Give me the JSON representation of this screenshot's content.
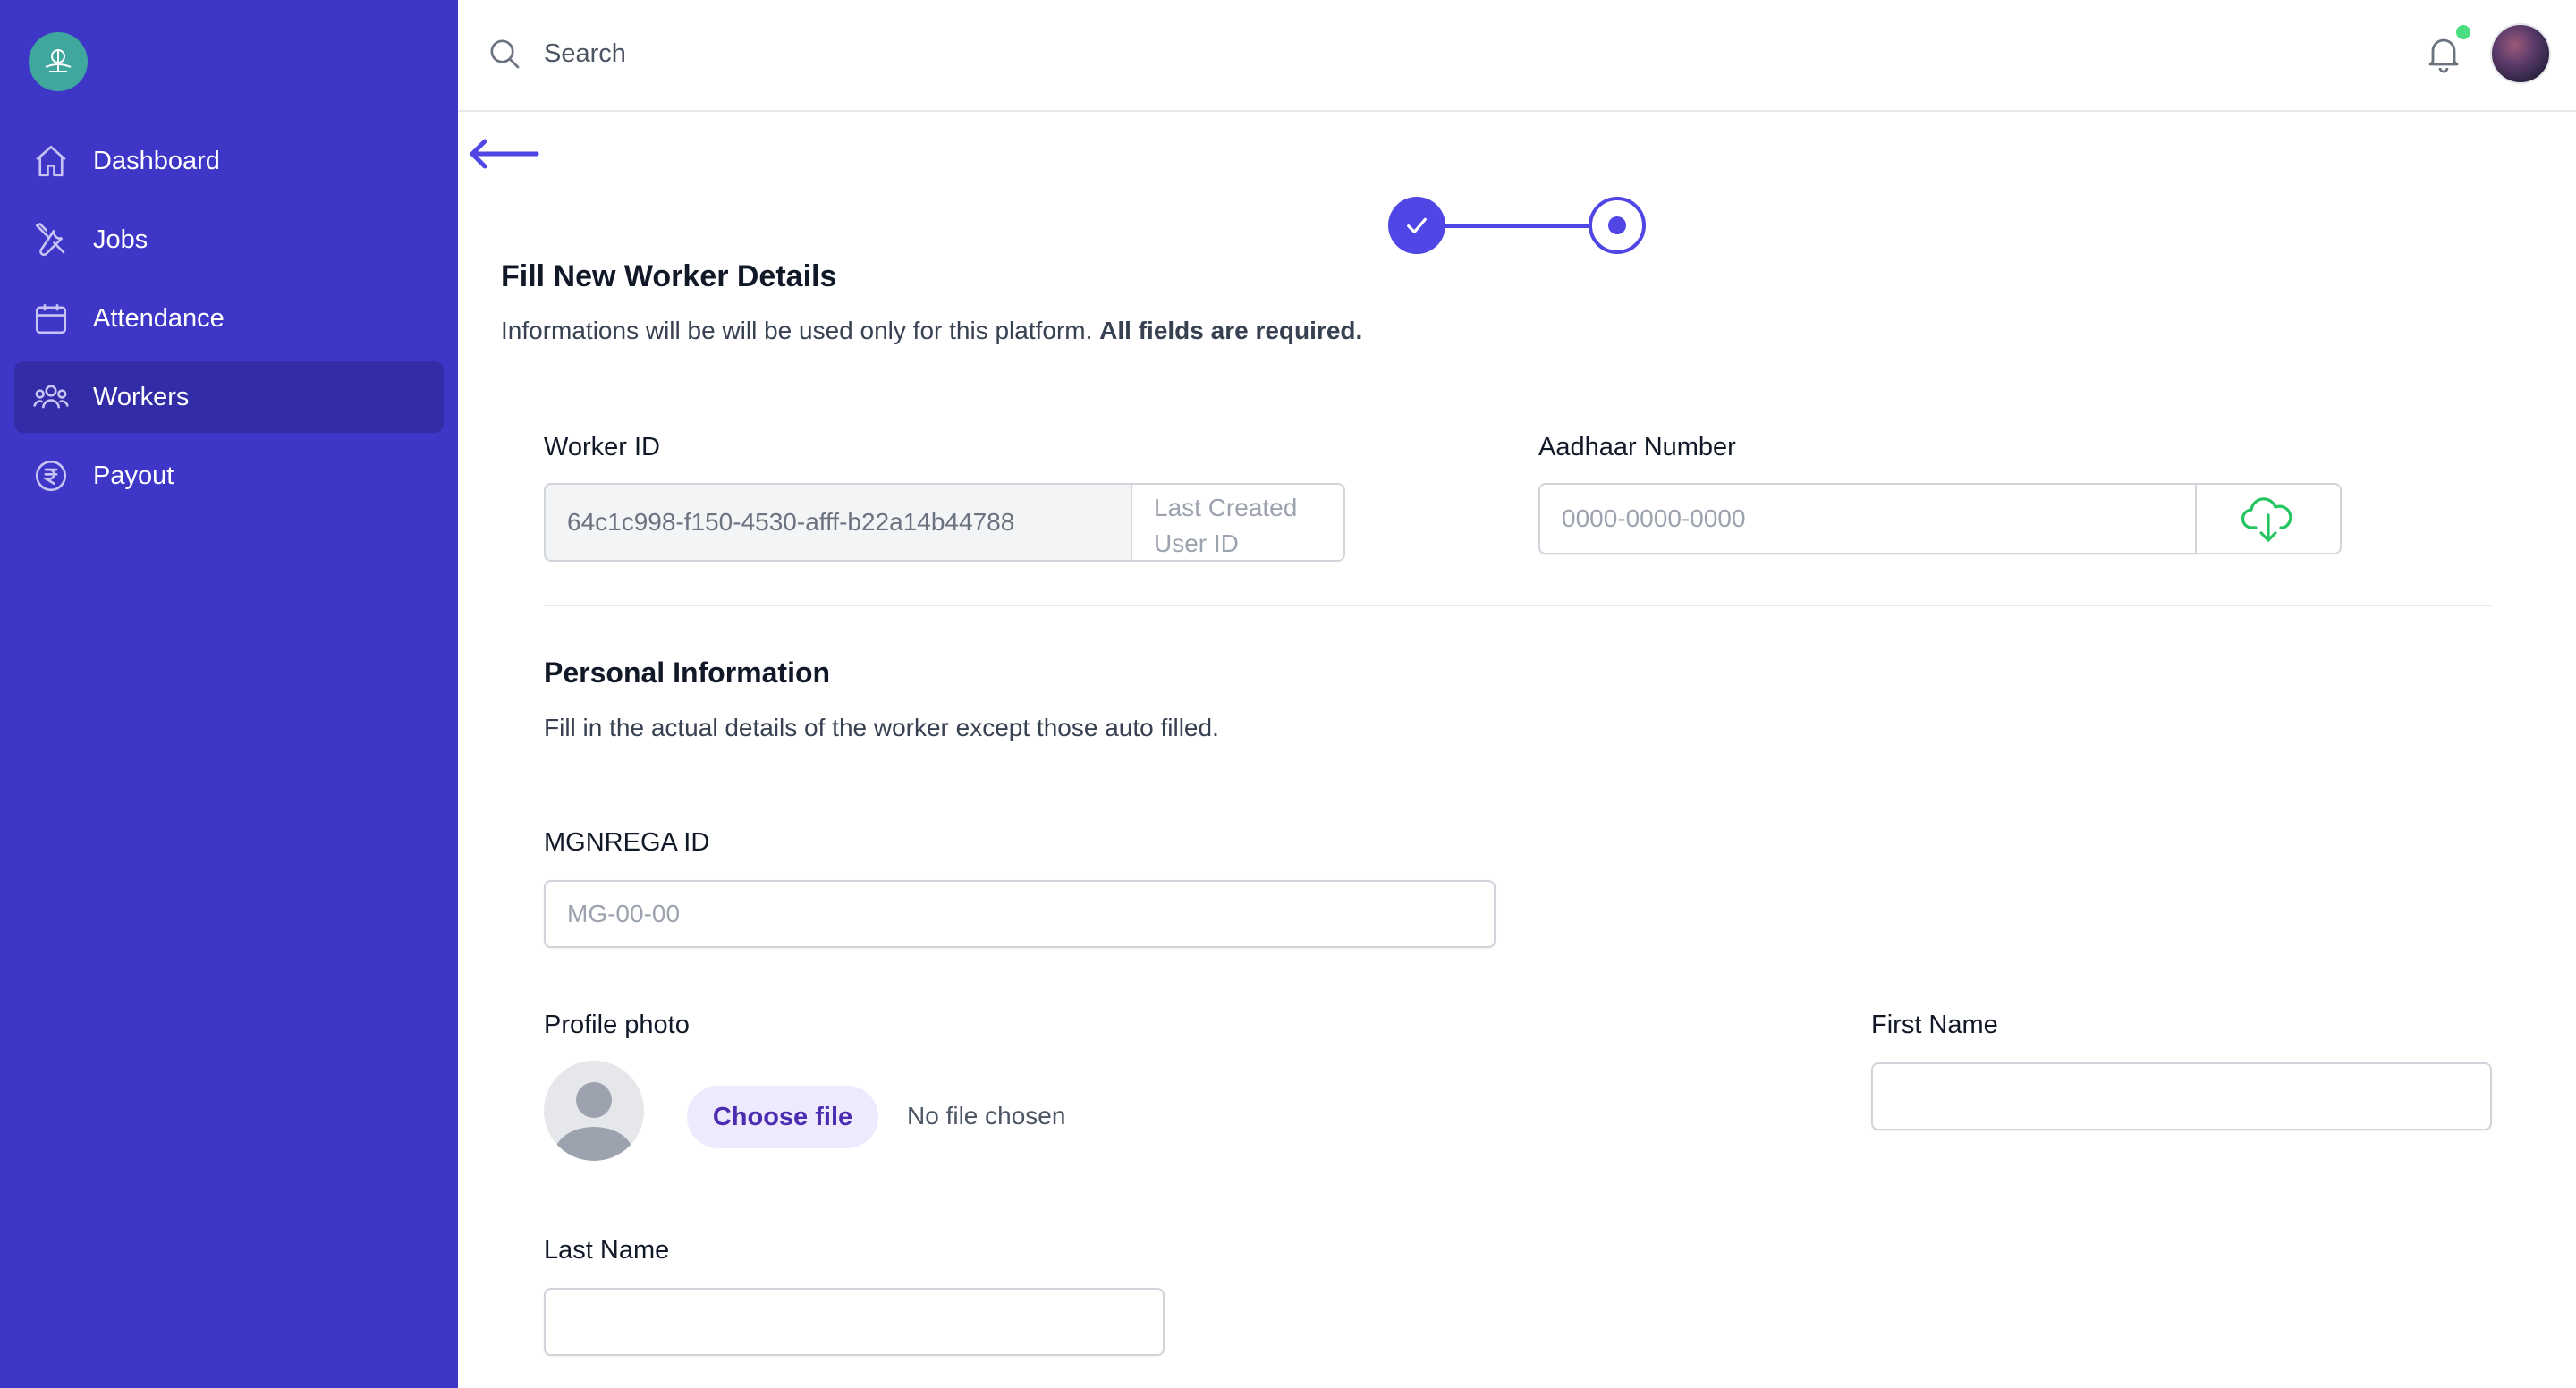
{
  "search": {
    "placeholder": "Search"
  },
  "sidebar": {
    "items": [
      {
        "label": "Dashboard",
        "icon": "home-icon"
      },
      {
        "label": "Jobs",
        "icon": "tools-icon"
      },
      {
        "label": "Attendance",
        "icon": "calendar-icon"
      },
      {
        "label": "Workers",
        "icon": "users-icon",
        "active": true
      },
      {
        "label": "Payout",
        "icon": "rupee-icon"
      }
    ]
  },
  "stepper": {
    "steps": [
      {
        "state": "complete"
      },
      {
        "state": "current"
      }
    ]
  },
  "form": {
    "title": "Fill New Worker Details",
    "description": "Informations will be will be used only for this platform.",
    "description_bold": "All fields are required.",
    "worker_id": {
      "label": "Worker ID",
      "value": "64c1c998-f150-4530-afff-b22a14b44788",
      "addon": "Last Created User ID"
    },
    "aadhaar": {
      "label": "Aadhaar Number",
      "placeholder": "0000-0000-0000"
    },
    "personal": {
      "title": "Personal Information",
      "description": "Fill in the actual details of the worker except those auto filled."
    },
    "mgnrega": {
      "label": "MGNREGA ID",
      "placeholder": "MG-00-00"
    },
    "profile_photo": {
      "label": "Profile photo",
      "button": "Choose file",
      "status": "No file chosen"
    },
    "first_name": {
      "label": "First Name",
      "value": ""
    },
    "last_name": {
      "label": "Last Name",
      "value": ""
    }
  },
  "colors": {
    "sidebar": "#3e36c6",
    "active": "#322ca6",
    "accent": "#4f46e5",
    "cloud": "#22c55e"
  }
}
